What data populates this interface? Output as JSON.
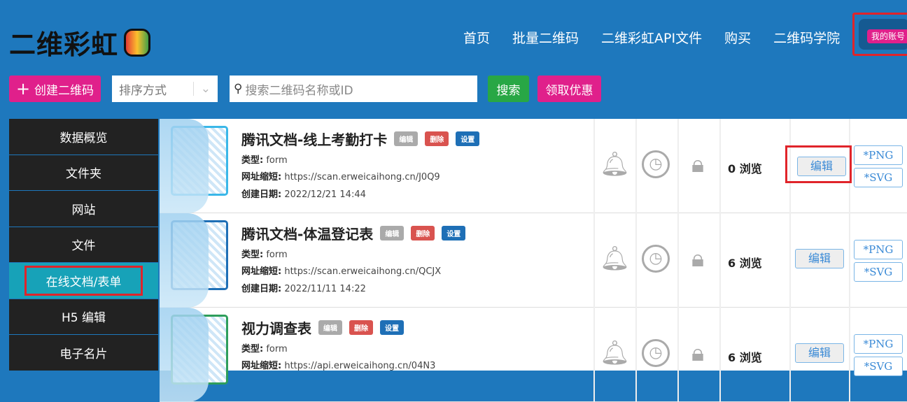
{
  "header": {
    "logo": "二维彩虹",
    "nav": [
      "首页",
      "批量二维码",
      "二维彩虹API文件",
      "购买",
      "二维码学院"
    ],
    "account": "我的账号"
  },
  "toolbar": {
    "create": "创建二维码",
    "sort": "排序方式",
    "search_placeholder": "搜索二维码名称或ID",
    "search": "搜索",
    "coupon": "领取优惠"
  },
  "sidebar": [
    "数据概览",
    "文件夹",
    "网站",
    "文件",
    "在线文档/表单",
    "H5 编辑",
    "电子名片"
  ],
  "labels": {
    "type": "类型:",
    "short": "网址缩短:",
    "created": "创建日期:",
    "tag_edit": "编辑",
    "tag_delete": "删除",
    "tag_settings": "设置",
    "edit": "编辑",
    "png": "*PNG",
    "svg": "*SVG"
  },
  "rows": [
    {
      "title": "腾讯文档-线上考勤打卡",
      "type": "form",
      "url": "https://scan.erweicaihong.cn/J0Q9",
      "date": "2022/12/21 14:44",
      "views": "0 浏览"
    },
    {
      "title": "腾讯文档-体温登记表",
      "type": "form",
      "url": "https://scan.erweicaihong.cn/QCJX",
      "date": "2022/11/11 14:22",
      "views": "6 浏览"
    },
    {
      "title": "视力调查表",
      "type": "form",
      "url": "https://api.erweicaihong.cn/04N3",
      "date": "",
      "views": "6 浏览"
    }
  ]
}
